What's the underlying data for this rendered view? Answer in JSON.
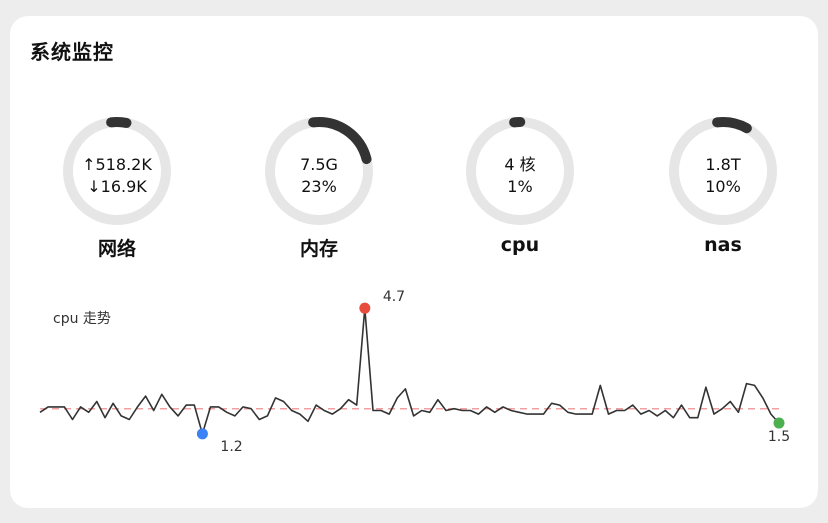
{
  "panel": {
    "title": "系统监控"
  },
  "gauges": [
    {
      "key": "network",
      "label": "网络",
      "line1": "↑518.2K",
      "line2": "↓16.9K",
      "percent": 0.05
    },
    {
      "key": "memory",
      "label": "内存",
      "line1": "7.5G",
      "line2": "23%",
      "percent": 0.23
    },
    {
      "key": "cpu",
      "label": "cpu",
      "line1": "4 核",
      "line2": "1%",
      "percent": 0.02
    },
    {
      "key": "nas",
      "label": "nas",
      "line1": "1.8T",
      "line2": "10%",
      "percent": 0.1
    }
  ],
  "colors": {
    "ring_track": "#e6e6e6",
    "ring_fill": "#333333",
    "line": "#333333",
    "avg_line": "#f0a0a0",
    "max_marker": "#e74c3c",
    "min_marker": "#3b82f6",
    "last_marker": "#4caf50"
  },
  "trend": {
    "title": "cpu 走势",
    "max_label": "4.7",
    "min_label": "1.2",
    "last_label": "1.5"
  },
  "chart_data": {
    "type": "line",
    "title": "cpu 走势",
    "ylim": [
      1.0,
      4.9
    ],
    "average": 1.9,
    "series": [
      {
        "values": [
          1.8,
          1.95,
          1.95,
          1.95,
          1.6,
          1.95,
          1.8,
          2.1,
          1.65,
          2.05,
          1.7,
          1.6,
          1.95,
          2.25,
          1.85,
          2.3,
          1.95,
          1.7,
          2.0,
          2.0,
          1.2,
          1.95,
          1.95,
          1.8,
          1.7,
          1.95,
          1.9,
          1.6,
          1.7,
          2.2,
          2.1,
          1.85,
          1.75,
          1.55,
          2.0,
          1.85,
          1.75,
          1.9,
          2.15,
          2.0,
          4.7,
          1.85,
          1.85,
          1.75,
          2.2,
          2.45,
          1.7,
          1.85,
          1.8,
          2.15,
          1.85,
          1.9,
          1.85,
          1.85,
          1.75,
          1.95,
          1.8,
          1.95,
          1.85,
          1.8,
          1.75,
          1.75,
          1.75,
          2.05,
          2.0,
          1.8,
          1.75,
          1.75,
          1.75,
          2.55,
          1.75,
          1.85,
          1.85,
          2.0,
          1.75,
          1.85,
          1.7,
          1.85,
          1.65,
          2.0,
          1.65,
          1.65,
          2.5,
          1.75,
          1.9,
          2.1,
          1.8,
          2.6,
          2.55,
          2.2,
          1.75,
          1.5
        ]
      }
    ],
    "annotations": [
      {
        "kind": "max",
        "value": 4.7,
        "label": "4.7"
      },
      {
        "kind": "min",
        "value": 1.2,
        "label": "1.2"
      },
      {
        "kind": "last",
        "value": 1.5,
        "label": "1.5"
      }
    ]
  }
}
